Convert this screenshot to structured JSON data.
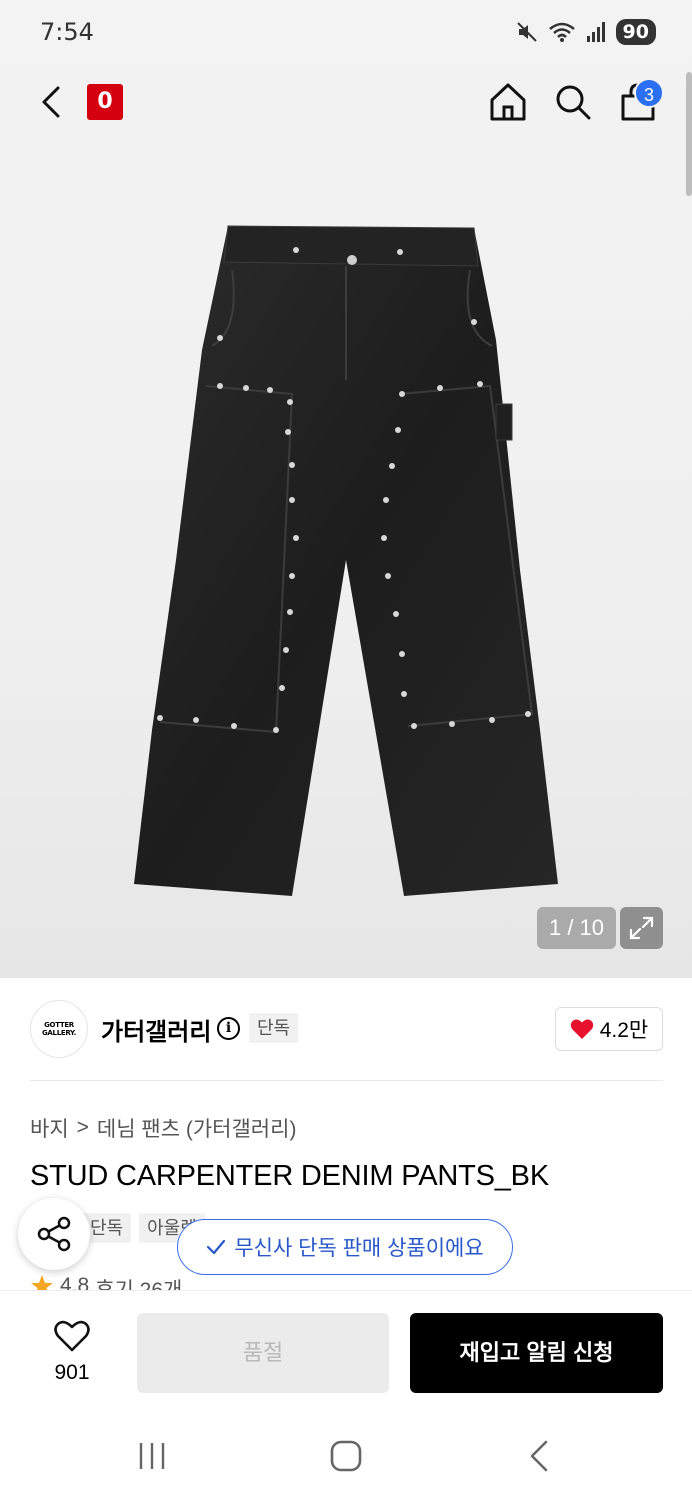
{
  "status_bar": {
    "time": "7:54",
    "battery": "90"
  },
  "nav": {
    "logo_text": "0",
    "cart_count": "3"
  },
  "gallery": {
    "counter": "1 / 10"
  },
  "brand": {
    "name": "가터갤러리",
    "info_icon": "i",
    "exclusive_tag": "단독",
    "logo_line1": "GOTTER",
    "logo_line2": "GALLERY.",
    "likes": "4.2만"
  },
  "breadcrumb": {
    "category": "바지",
    "separator": ">",
    "subcategory": "데님 팬츠 (가터갤러리)"
  },
  "product": {
    "title": "STUD CARPENTER DENIM PANTS_BK"
  },
  "tags": [
    "단독",
    "아울렛"
  ],
  "toast": {
    "text": "무신사 단독 판매 상품이에요"
  },
  "rating": {
    "score": "4.8",
    "reviews": "후기 26개"
  },
  "bottom": {
    "wishlist_count": "901",
    "soldout_label": "품절",
    "restock_label": "재입고 알림 신청"
  },
  "colors": {
    "brand_red": "#d4000f",
    "toast_blue": "#2857c9",
    "badge_blue": "#2b6ff3",
    "heart_red": "#e8112d"
  },
  "icons": [
    "back-arrow-icon",
    "home-icon",
    "search-icon",
    "cart-icon",
    "expand-icon",
    "info-icon",
    "heart-icon",
    "share-icon",
    "check-icon",
    "star-icon"
  ]
}
